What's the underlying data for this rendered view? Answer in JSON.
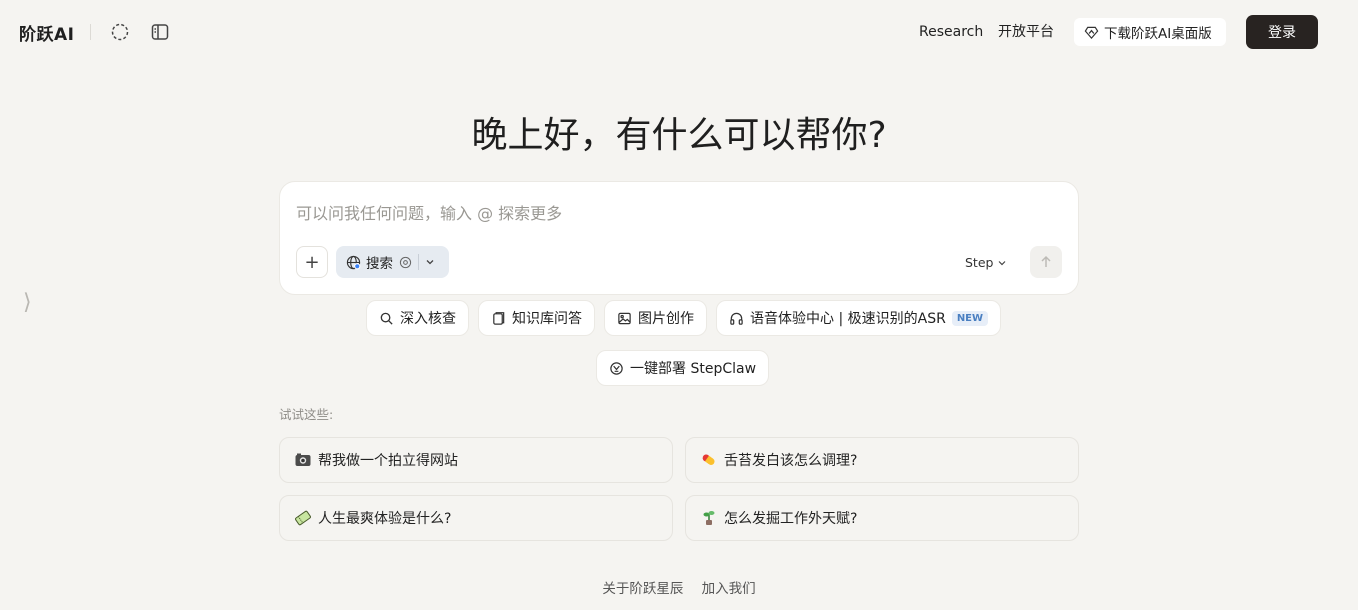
{
  "header": {
    "logo": "阶跃AI",
    "nav": [
      "Research",
      "开放平台"
    ],
    "download_label": "下载阶跃AI桌面版",
    "login_label": "登录"
  },
  "greeting": "晚上好，有什么可以帮你?",
  "composer": {
    "placeholder": "可以问我任何问题，输入 @ 探索更多",
    "search_label": "搜索",
    "model_label": "Step"
  },
  "features": [
    {
      "label": "深入核查",
      "icon": "magnifier-icon"
    },
    {
      "label": "知识库问答",
      "icon": "knowledge-base-icon"
    },
    {
      "label": "图片创作",
      "icon": "image-icon"
    },
    {
      "label": "语音体验中心 | 极速识别的ASR",
      "icon": "headphones-icon",
      "badge": "NEW"
    },
    {
      "label": "一键部署 StepClaw",
      "icon": "claw-icon"
    }
  ],
  "suggestions": {
    "title": "试试这些:",
    "items": [
      {
        "label": "帮我做一个拍立得网站",
        "icon": "camera-icon"
      },
      {
        "label": "舌苔发白该怎么调理?",
        "icon": "pill-icon"
      },
      {
        "label": "人生最爽体验是什么?",
        "icon": "ticket-icon"
      },
      {
        "label": "怎么发掘工作外天赋?",
        "icon": "plant-icon"
      }
    ]
  },
  "footer": {
    "links": [
      "关于阶跃星辰",
      "加入我们"
    ]
  }
}
